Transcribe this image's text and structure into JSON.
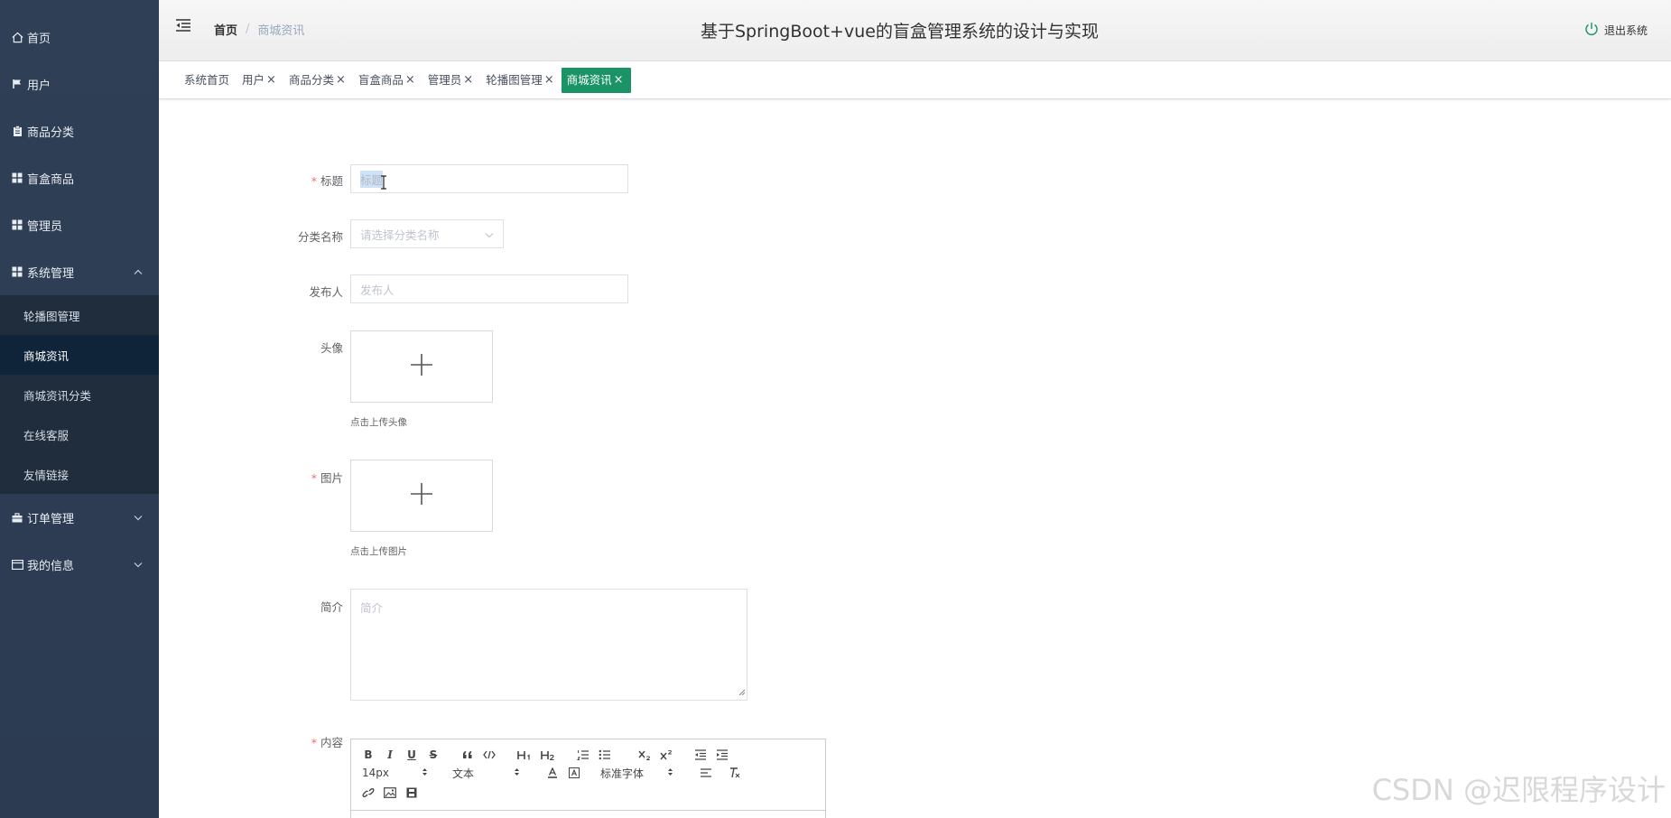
{
  "sidebar": {
    "items": [
      {
        "label": "首页",
        "icon": "home-icon"
      },
      {
        "label": "用户",
        "icon": "flag-icon"
      },
      {
        "label": "商品分类",
        "icon": "clipboard-icon"
      },
      {
        "label": "盲盒商品",
        "icon": "grid-icon"
      },
      {
        "label": "管理员",
        "icon": "grid-icon"
      },
      {
        "label": "系统管理",
        "icon": "grid-icon",
        "expanded": true
      }
    ],
    "submenu": [
      {
        "label": "轮播图管理"
      },
      {
        "label": "商城资讯",
        "active": true
      },
      {
        "label": "商城资讯分类"
      },
      {
        "label": "在线客服"
      },
      {
        "label": "友情链接"
      }
    ],
    "bottom_items": [
      {
        "label": "订单管理",
        "icon": "briefcase-icon"
      },
      {
        "label": "我的信息",
        "icon": "card-icon"
      }
    ]
  },
  "header": {
    "breadcrumb_home": "首页",
    "breadcrumb_current": "商城资讯",
    "title": "基于SpringBoot+vue的盲盒管理系统的设计与实现",
    "logout_label": "退出系统"
  },
  "tags": [
    {
      "label": "系统首页",
      "closable": false
    },
    {
      "label": "用户",
      "closable": true
    },
    {
      "label": "商品分类",
      "closable": true
    },
    {
      "label": "盲盒商品",
      "closable": true
    },
    {
      "label": "管理员",
      "closable": true
    },
    {
      "label": "轮播图管理",
      "closable": true
    },
    {
      "label": "商城资讯",
      "closable": true,
      "active": true
    }
  ],
  "tag_close_glyph": "×",
  "form": {
    "title_label": "标题",
    "title_placeholder": "标题",
    "category_label": "分类名称",
    "category_placeholder": "请选择分类名称",
    "publisher_label": "发布人",
    "publisher_placeholder": "发布人",
    "avatar_label": "头像",
    "avatar_hint": "点击上传头像",
    "image_label": "图片",
    "image_hint": "点击上传图片",
    "intro_label": "简介",
    "intro_placeholder": "简介",
    "content_label": "内容",
    "required_mark": "*"
  },
  "editor": {
    "font_size": "14px",
    "header_select": "文本",
    "font_family": "标准字体"
  },
  "watermark": "CSDN @迟限程序设计",
  "colors": {
    "sidebar_bg": "#2f3f55",
    "submenu_bg": "#1f2d3d",
    "active_tag": "#1a9367",
    "required": "#f56c6c"
  }
}
